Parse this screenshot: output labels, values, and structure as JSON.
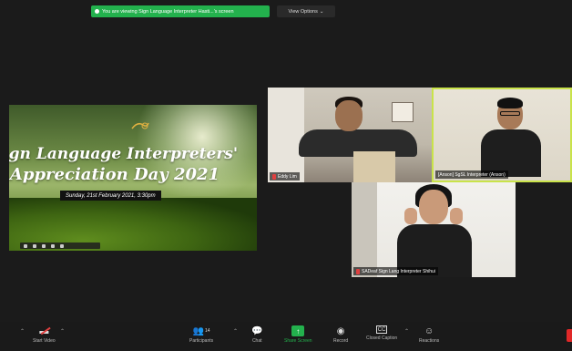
{
  "banner": {
    "share_text": "You are viewing Sign Language Interpreter Hasti...'s screen",
    "view_options": "View Options",
    "view_options_caret": "⌄"
  },
  "slide": {
    "title_line1": "Sign Language Interpreters'",
    "title_line2": "Appreciation Day 2021",
    "date": "Sunday, 21st February 2021, 3:30pm"
  },
  "participants": [
    {
      "name": "Eddy Lim"
    },
    {
      "name": "[Anson] SgSL Interpreter (Anson)"
    },
    {
      "name": "SADeaf Sign Lang Interpreter Shihui"
    }
  ],
  "toolbar": {
    "items": [
      {
        "label": "Start Video",
        "icon": "video-off-icon"
      },
      {
        "label": "Participants",
        "icon": "participants-icon",
        "count": "14"
      },
      {
        "label": "Chat",
        "icon": "chat-icon"
      },
      {
        "label": "Share Screen",
        "icon": "share-screen-icon"
      },
      {
        "label": "Record",
        "icon": "record-icon"
      },
      {
        "label": "Closed Caption",
        "icon": "cc-icon"
      },
      {
        "label": "Reactions",
        "icon": "reactions-icon"
      }
    ]
  },
  "colors": {
    "share_green": "#23b14d",
    "active_speaker_border": "#c9e34a",
    "end_red": "#e02828"
  }
}
